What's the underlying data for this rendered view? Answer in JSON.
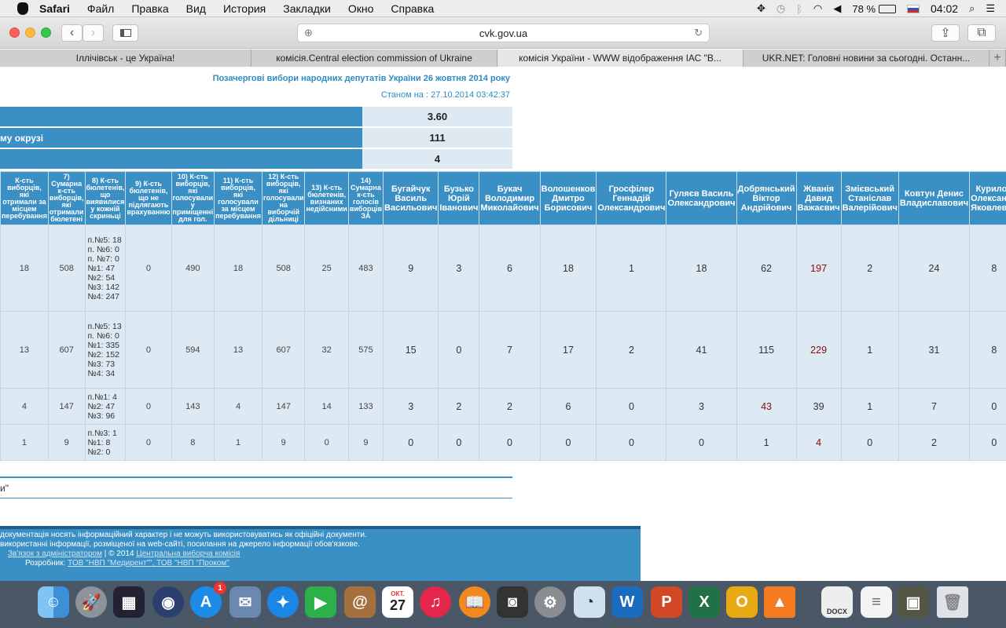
{
  "menubar": {
    "app": "Safari",
    "items": [
      "Файл",
      "Правка",
      "Вид",
      "История",
      "Закладки",
      "Окно",
      "Справка"
    ],
    "battery": "78 %",
    "time": "04:02"
  },
  "browser": {
    "url": "cvk.gov.ua",
    "tabs": [
      "Іллічівськ - це Україна!",
      "комісія.Central election commission of Ukraine",
      "комісія України - WWW відображення ІАС \"В...",
      "UKR.NET: Головні новини за сьогодні. Останн..."
    ]
  },
  "page": {
    "title": "Позачергові вибори народних депутатів України 26 жовтня 2014 року",
    "status": "Станом на : 27.10.2014 03:42:37",
    "summary": [
      {
        "label": "",
        "value": "3.60"
      },
      {
        "label": "му окрузі",
        "value": "111"
      },
      {
        "label": "",
        "value": "4"
      }
    ],
    "headers": [
      "К-сть виборців, які отримали за місцем перебування",
      "7) Сумарна к-сть виборців, які отримали бюлетені",
      "8) К-сть бюлетенів, що виявилися у кожній скриньці",
      "9) К-сть бюлетенів, що не підлягають врахуванню",
      "10) К-сть виборців, які голосували у приміщенні для гол.",
      "11) К-сть виборців, які голосували за місцем перебування",
      "12) К-сть виборців, які голосували на виборчій дільниці",
      "13) К-сть бюлетенів, визнаних недійсними",
      "14) Сумарна к-сть голосів виборців ЗА"
    ],
    "candidates": [
      "Бугайчук Василь Васильович",
      "Бузько Юрій Іванович",
      "Букач Володимир Миколайович",
      "Волошенков Дмитро Борисович",
      "Гросфілер Геннадій Олександрович",
      "Гуляєв Василь Олександрович",
      "Добрянський Віктор Андрійович",
      "Жванія Давид Важаєвич",
      "Змієвський Станіслав Валерійович",
      "Ковтун Денис Владиславович",
      "Курилов Олександр Яковлевич"
    ],
    "rows": [
      {
        "a": "18",
        "b": "508",
        "notes": "п.№5: 18 п. №6: 0 п. №7: 0 №1: 47 №2: 54 №3: 142 №4: 247",
        "c": "0",
        "d": "490",
        "e": "18",
        "f": "508",
        "g": "25",
        "h": "483",
        "v": [
          "9",
          "3",
          "6",
          "18",
          "1",
          "18",
          "62",
          "197",
          "2",
          "24",
          "8"
        ]
      },
      {
        "a": "13",
        "b": "607",
        "notes": "п.№5: 13 п. №6: 0 №1: 335 №2: 152 №3: 73 №4: 34",
        "c": "0",
        "d": "594",
        "e": "13",
        "f": "607",
        "g": "32",
        "h": "575",
        "v": [
          "15",
          "0",
          "7",
          "17",
          "2",
          "41",
          "115",
          "229",
          "1",
          "31",
          "8"
        ]
      },
      {
        "a": "4",
        "b": "147",
        "notes": "п.№1: 4 №2: 47 №3: 96",
        "c": "0",
        "d": "143",
        "e": "4",
        "f": "147",
        "g": "14",
        "h": "133",
        "v": [
          "3",
          "2",
          "2",
          "6",
          "0",
          "3",
          "43",
          "39",
          "1",
          "7",
          "0"
        ]
      },
      {
        "a": "1",
        "b": "9",
        "notes": "п.№3: 1 №1: 8 №2: 0",
        "c": "0",
        "d": "8",
        "e": "1",
        "f": "9",
        "g": "0",
        "h": "9",
        "v": [
          "0",
          "0",
          "0",
          "0",
          "0",
          "0",
          "1",
          "4",
          "0",
          "2",
          "0"
        ]
      }
    ],
    "bottom_text": "и\"",
    "footer": {
      "line1": "документація носять інформаційний характер і не можуть використовуватись як офіційні документи.",
      "line2": "використанні інформації, розміщеної на web-сайті, посилання на джерело інформації обов'язкове.",
      "contact_link": "Зв'язок з адміністратором",
      "copyright": "| © 2014",
      "cec_link": "Центральна виборча комісія",
      "dev_label": "Розробник:",
      "dev_link": "ТОВ \"НВП \"Медирент\"\", ТОВ \"НВП \"Проком\""
    }
  },
  "dock": {
    "calendar_month": "ОКТ.",
    "calendar_day": "27",
    "appstore_badge": "1",
    "docx_label": "DOCX"
  }
}
